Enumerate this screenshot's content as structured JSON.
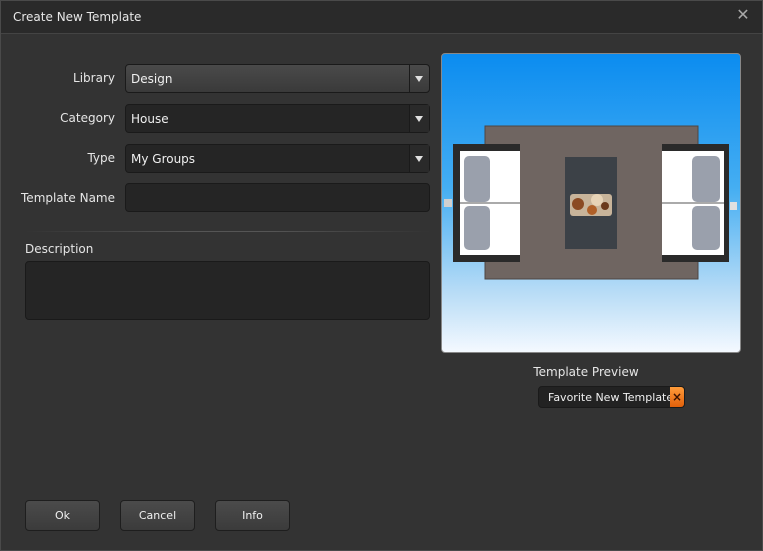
{
  "window": {
    "title": "Create New Template",
    "close_icon": "close-icon"
  },
  "form": {
    "library": {
      "label": "Library",
      "value": "Design"
    },
    "category": {
      "label": "Category",
      "value": "House"
    },
    "type": {
      "label": "Type",
      "value": "My Groups"
    },
    "template_name": {
      "label": "Template Name",
      "value": ""
    },
    "description": {
      "label": "Description",
      "value": ""
    }
  },
  "preview": {
    "caption": "Template Preview",
    "favorite_label": "Favorite New Template",
    "favorite_close_icon": "×"
  },
  "buttons": {
    "ok": "Ok",
    "cancel": "Cancel",
    "info": "Info"
  },
  "colors": {
    "accent": "#f07a1a",
    "sky_top": "#0b8cf0",
    "sky_bottom": "#f4f9ff"
  }
}
